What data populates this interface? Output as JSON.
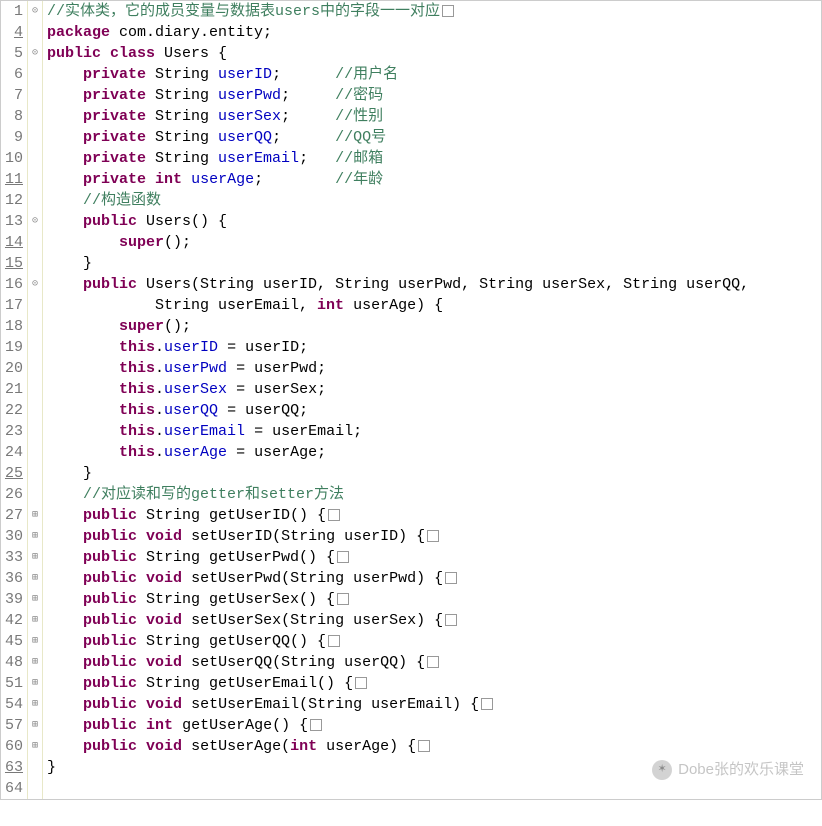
{
  "watermark": "Dobe张的欢乐课堂",
  "lines": [
    {
      "n": "1",
      "u": false,
      "f": "⊝",
      "tokens": [
        [
          "cm",
          "//实体类，它的成员变量与数据表users中的字段一一对应"
        ],
        [
          "sq",
          ""
        ]
      ]
    },
    {
      "n": "4",
      "u": true,
      "f": "",
      "tokens": [
        [
          "kw",
          "package"
        ],
        [
          "pln",
          " com.diary.entity;"
        ]
      ]
    },
    {
      "n": "5",
      "u": false,
      "f": "⊝",
      "tokens": [
        [
          "kw",
          "public"
        ],
        [
          "pln",
          " "
        ],
        [
          "kw",
          "class"
        ],
        [
          "pln",
          " Users {"
        ]
      ]
    },
    {
      "n": "6",
      "u": false,
      "f": "",
      "tokens": [
        [
          "pln",
          "    "
        ],
        [
          "kw",
          "private"
        ],
        [
          "pln",
          " String "
        ],
        [
          "fld",
          "userID"
        ],
        [
          "pln",
          ";      "
        ],
        [
          "cm",
          "//用户名"
        ]
      ]
    },
    {
      "n": "7",
      "u": false,
      "f": "",
      "tokens": [
        [
          "pln",
          "    "
        ],
        [
          "kw",
          "private"
        ],
        [
          "pln",
          " String "
        ],
        [
          "fld",
          "userPwd"
        ],
        [
          "pln",
          ";     "
        ],
        [
          "cm",
          "//密码"
        ]
      ]
    },
    {
      "n": "8",
      "u": false,
      "f": "",
      "tokens": [
        [
          "pln",
          "    "
        ],
        [
          "kw",
          "private"
        ],
        [
          "pln",
          " String "
        ],
        [
          "fld",
          "userSex"
        ],
        [
          "pln",
          ";     "
        ],
        [
          "cm",
          "//性别"
        ]
      ]
    },
    {
      "n": "9",
      "u": false,
      "f": "",
      "tokens": [
        [
          "pln",
          "    "
        ],
        [
          "kw",
          "private"
        ],
        [
          "pln",
          " String "
        ],
        [
          "fld",
          "userQQ"
        ],
        [
          "pln",
          ";      "
        ],
        [
          "cm",
          "//QQ号"
        ]
      ]
    },
    {
      "n": "10",
      "u": false,
      "f": "",
      "tokens": [
        [
          "pln",
          "    "
        ],
        [
          "kw",
          "private"
        ],
        [
          "pln",
          " String "
        ],
        [
          "fld",
          "userEmail"
        ],
        [
          "pln",
          ";   "
        ],
        [
          "cm",
          "//邮箱"
        ]
      ]
    },
    {
      "n": "11",
      "u": true,
      "f": "",
      "tokens": [
        [
          "pln",
          "    "
        ],
        [
          "kw",
          "private"
        ],
        [
          "pln",
          " "
        ],
        [
          "kw",
          "int"
        ],
        [
          "pln",
          " "
        ],
        [
          "fld",
          "userAge"
        ],
        [
          "pln",
          ";        "
        ],
        [
          "cm",
          "//年龄"
        ]
      ]
    },
    {
      "n": "12",
      "u": false,
      "f": "",
      "tokens": [
        [
          "pln",
          "    "
        ],
        [
          "cm",
          "//构造函数"
        ]
      ]
    },
    {
      "n": "13",
      "u": false,
      "f": "⊝",
      "tokens": [
        [
          "pln",
          "    "
        ],
        [
          "kw",
          "public"
        ],
        [
          "pln",
          " Users() {"
        ]
      ]
    },
    {
      "n": "14",
      "u": true,
      "f": "",
      "tokens": [
        [
          "pln",
          "        "
        ],
        [
          "kw",
          "super"
        ],
        [
          "pln",
          "();"
        ]
      ]
    },
    {
      "n": "15",
      "u": true,
      "f": "",
      "tokens": [
        [
          "pln",
          "    }"
        ]
      ]
    },
    {
      "n": "16",
      "u": false,
      "f": "⊝",
      "tokens": [
        [
          "pln",
          "    "
        ],
        [
          "kw",
          "public"
        ],
        [
          "pln",
          " Users(String userID, String userPwd, String userSex, String userQQ,"
        ]
      ]
    },
    {
      "n": "17",
      "u": false,
      "f": "",
      "tokens": [
        [
          "pln",
          "            String userEmail, "
        ],
        [
          "kw",
          "int"
        ],
        [
          "pln",
          " userAge) {"
        ]
      ]
    },
    {
      "n": "18",
      "u": false,
      "f": "",
      "tokens": [
        [
          "pln",
          "        "
        ],
        [
          "kw",
          "super"
        ],
        [
          "pln",
          "();"
        ]
      ]
    },
    {
      "n": "19",
      "u": false,
      "f": "",
      "tokens": [
        [
          "pln",
          "        "
        ],
        [
          "kw",
          "this"
        ],
        [
          "pln",
          "."
        ],
        [
          "fld",
          "userID"
        ],
        [
          "pln",
          " = userID;"
        ]
      ]
    },
    {
      "n": "20",
      "u": false,
      "f": "",
      "tokens": [
        [
          "pln",
          "        "
        ],
        [
          "kw",
          "this"
        ],
        [
          "pln",
          "."
        ],
        [
          "fld",
          "userPwd"
        ],
        [
          "pln",
          " = userPwd;"
        ]
      ]
    },
    {
      "n": "21",
      "u": false,
      "f": "",
      "tokens": [
        [
          "pln",
          "        "
        ],
        [
          "kw",
          "this"
        ],
        [
          "pln",
          "."
        ],
        [
          "fld",
          "userSex"
        ],
        [
          "pln",
          " = userSex;"
        ]
      ]
    },
    {
      "n": "22",
      "u": false,
      "f": "",
      "tokens": [
        [
          "pln",
          "        "
        ],
        [
          "kw",
          "this"
        ],
        [
          "pln",
          "."
        ],
        [
          "fld",
          "userQQ"
        ],
        [
          "pln",
          " = userQQ;"
        ]
      ]
    },
    {
      "n": "23",
      "u": false,
      "f": "",
      "tokens": [
        [
          "pln",
          "        "
        ],
        [
          "kw",
          "this"
        ],
        [
          "pln",
          "."
        ],
        [
          "fld",
          "userEmail"
        ],
        [
          "pln",
          " = userEmail;"
        ]
      ]
    },
    {
      "n": "24",
      "u": false,
      "f": "",
      "tokens": [
        [
          "pln",
          "        "
        ],
        [
          "kw",
          "this"
        ],
        [
          "pln",
          "."
        ],
        [
          "fld",
          "userAge"
        ],
        [
          "pln",
          " = userAge;"
        ]
      ]
    },
    {
      "n": "25",
      "u": true,
      "f": "",
      "tokens": [
        [
          "pln",
          "    }"
        ]
      ]
    },
    {
      "n": "26",
      "u": false,
      "f": "",
      "tokens": [
        [
          "pln",
          "    "
        ],
        [
          "cm",
          "//对应读和写的getter和setter方法"
        ]
      ]
    },
    {
      "n": "27",
      "u": false,
      "f": "⊞",
      "tokens": [
        [
          "pln",
          "    "
        ],
        [
          "kw",
          "public"
        ],
        [
          "pln",
          " String getUserID() {"
        ],
        [
          "sq",
          ""
        ]
      ]
    },
    {
      "n": "30",
      "u": false,
      "f": "⊞",
      "tokens": [
        [
          "pln",
          "    "
        ],
        [
          "kw",
          "public"
        ],
        [
          "pln",
          " "
        ],
        [
          "kw",
          "void"
        ],
        [
          "pln",
          " setUserID(String userID) {"
        ],
        [
          "sq",
          ""
        ]
      ]
    },
    {
      "n": "33",
      "u": false,
      "f": "⊞",
      "tokens": [
        [
          "pln",
          "    "
        ],
        [
          "kw",
          "public"
        ],
        [
          "pln",
          " String getUserPwd() {"
        ],
        [
          "sq",
          ""
        ]
      ]
    },
    {
      "n": "36",
      "u": false,
      "f": "⊞",
      "tokens": [
        [
          "pln",
          "    "
        ],
        [
          "kw",
          "public"
        ],
        [
          "pln",
          " "
        ],
        [
          "kw",
          "void"
        ],
        [
          "pln",
          " setUserPwd(String userPwd) {"
        ],
        [
          "sq",
          ""
        ]
      ]
    },
    {
      "n": "39",
      "u": false,
      "f": "⊞",
      "tokens": [
        [
          "pln",
          "    "
        ],
        [
          "kw",
          "public"
        ],
        [
          "pln",
          " String getUserSex() {"
        ],
        [
          "sq",
          ""
        ]
      ]
    },
    {
      "n": "42",
      "u": false,
      "f": "⊞",
      "tokens": [
        [
          "pln",
          "    "
        ],
        [
          "kw",
          "public"
        ],
        [
          "pln",
          " "
        ],
        [
          "kw",
          "void"
        ],
        [
          "pln",
          " setUserSex(String userSex) {"
        ],
        [
          "sq",
          ""
        ]
      ]
    },
    {
      "n": "45",
      "u": false,
      "f": "⊞",
      "tokens": [
        [
          "pln",
          "    "
        ],
        [
          "kw",
          "public"
        ],
        [
          "pln",
          " String getUserQQ() {"
        ],
        [
          "sq",
          ""
        ]
      ]
    },
    {
      "n": "48",
      "u": false,
      "f": "⊞",
      "tokens": [
        [
          "pln",
          "    "
        ],
        [
          "kw",
          "public"
        ],
        [
          "pln",
          " "
        ],
        [
          "kw",
          "void"
        ],
        [
          "pln",
          " setUserQQ(String userQQ) {"
        ],
        [
          "sq",
          ""
        ]
      ]
    },
    {
      "n": "51",
      "u": false,
      "f": "⊞",
      "tokens": [
        [
          "pln",
          "    "
        ],
        [
          "kw",
          "public"
        ],
        [
          "pln",
          " String getUserEmail() {"
        ],
        [
          "sq",
          ""
        ]
      ]
    },
    {
      "n": "54",
      "u": false,
      "f": "⊞",
      "tokens": [
        [
          "pln",
          "    "
        ],
        [
          "kw",
          "public"
        ],
        [
          "pln",
          " "
        ],
        [
          "kw",
          "void"
        ],
        [
          "pln",
          " setUserEmail(String userEmail) {"
        ],
        [
          "sq",
          ""
        ]
      ]
    },
    {
      "n": "57",
      "u": false,
      "f": "⊞",
      "tokens": [
        [
          "pln",
          "    "
        ],
        [
          "kw",
          "public"
        ],
        [
          "pln",
          " "
        ],
        [
          "kw",
          "int"
        ],
        [
          "pln",
          " getUserAge() {"
        ],
        [
          "sq",
          ""
        ]
      ]
    },
    {
      "n": "60",
      "u": false,
      "f": "⊞",
      "tokens": [
        [
          "pln",
          "    "
        ],
        [
          "kw",
          "public"
        ],
        [
          "pln",
          " "
        ],
        [
          "kw",
          "void"
        ],
        [
          "pln",
          " setUserAge("
        ],
        [
          "kw",
          "int"
        ],
        [
          "pln",
          " userAge) {"
        ],
        [
          "sq",
          ""
        ]
      ]
    },
    {
      "n": "63",
      "u": true,
      "f": "",
      "tokens": [
        [
          "pln",
          "}"
        ]
      ]
    },
    {
      "n": "64",
      "u": false,
      "f": "",
      "tokens": [
        [
          "pln",
          ""
        ]
      ]
    }
  ]
}
